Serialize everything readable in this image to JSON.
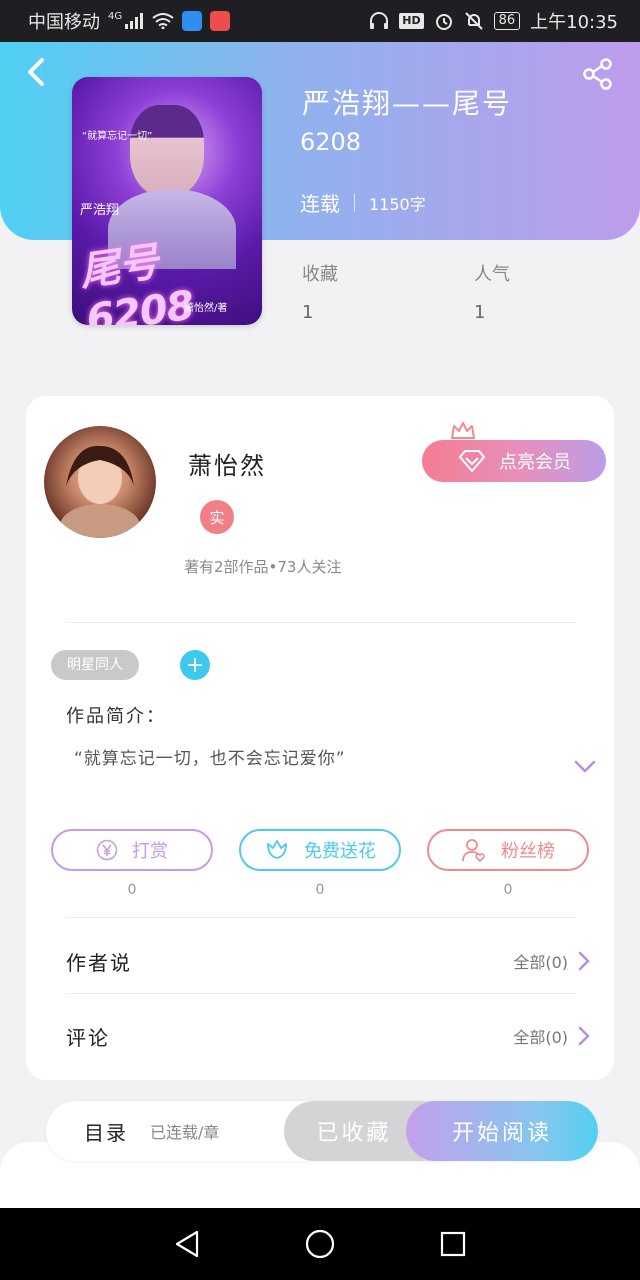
{
  "status_bar": {
    "carrier": "中国移动",
    "network": "4G",
    "battery": "86",
    "time": "上午10:35",
    "hd": "HD"
  },
  "header": {
    "title": "严浩翔——尾号",
    "subtitle": "6208",
    "status": "连载",
    "word_count": "1150字"
  },
  "cover": {
    "big_text": "尾号6208",
    "name_text": "严浩翔",
    "slogan": "“就算忘记一切”",
    "credit": "萧怡然/著"
  },
  "stats": {
    "collect_label": "收藏",
    "collect_value": "1",
    "popularity_label": "人气",
    "popularity_value": "1"
  },
  "author": {
    "name": "萧怡然",
    "badge": "实",
    "meta": "著有2部作品•73人关注",
    "vip_button": "点亮会员"
  },
  "tags": {
    "chip": "明星同人",
    "add": "+"
  },
  "intro": {
    "label": "作品简介：",
    "text": "“就算忘记一切，也不会忘记爱你”"
  },
  "actions": [
    {
      "label": "打赏",
      "count": "0",
      "color": "#c49be6"
    },
    {
      "label": "免费送花",
      "count": "0",
      "color": "#4ccbee"
    },
    {
      "label": "粉丝榜",
      "count": "0",
      "color": "#f08a8f"
    }
  ],
  "rows": {
    "author_says": "作者说",
    "author_says_right": "全部(0)",
    "comments": "评论",
    "comments_right": "全部(0)"
  },
  "bottom": {
    "toc_label": "目录",
    "toc_sub": "已连载/章",
    "collected": "已收藏",
    "start_reading": "开始阅读"
  },
  "colors": {
    "accent_purple": "#c49be6",
    "accent_cyan": "#4ccbee",
    "accent_pink": "#f08a8f"
  }
}
